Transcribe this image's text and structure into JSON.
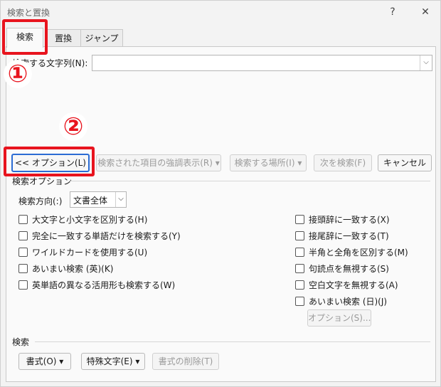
{
  "window": {
    "title": "検索と置換",
    "help": "?",
    "close": "✕"
  },
  "tabs": [
    {
      "label": "検索"
    },
    {
      "label": "置換"
    },
    {
      "label": "ジャンプ"
    }
  ],
  "find": {
    "label": "検索する文字列(N):",
    "value": ""
  },
  "buttons": {
    "options": "<< オプション(L)",
    "highlight": "検索された項目の強調表示(R) ▾",
    "search_in": "検索する場所(I) ▾",
    "find_next": "次を検索(F)",
    "cancel": "キャンセル"
  },
  "options_group": {
    "title": "検索オプション",
    "direction_label": "検索方向(:)",
    "direction_value": "文書全体",
    "left_checks": [
      {
        "label": "大文字と小文字を区別する(H)",
        "checked": false
      },
      {
        "label": "完全に一致する単語だけを検索する(Y)",
        "checked": false
      },
      {
        "label": "ワイルドカードを使用する(U)",
        "checked": false
      },
      {
        "label": "あいまい検索 (英)(K)",
        "checked": false
      },
      {
        "label": "英単語の異なる活用形も検索する(W)",
        "checked": false
      }
    ],
    "right_checks": [
      {
        "label": "接頭辞に一致する(X)",
        "checked": false
      },
      {
        "label": "接尾辞に一致する(T)",
        "checked": false
      },
      {
        "label": "半角と全角を区別する(M)",
        "checked": false
      },
      {
        "label": "句読点を無視する(S)",
        "checked": false
      },
      {
        "label": "空白文字を無視する(A)",
        "checked": false
      },
      {
        "label": "あいまい検索 (日)(J)",
        "checked": false
      }
    ],
    "fuzzy_options_button": "オプション(S)..."
  },
  "search_group": {
    "title": "検索",
    "format": "書式(O) ▾",
    "special": "特殊文字(E) ▾",
    "clear_format": "書式の削除(T)"
  },
  "annotations": {
    "step1": "①",
    "step2": "②",
    "color": "#e8141e"
  }
}
